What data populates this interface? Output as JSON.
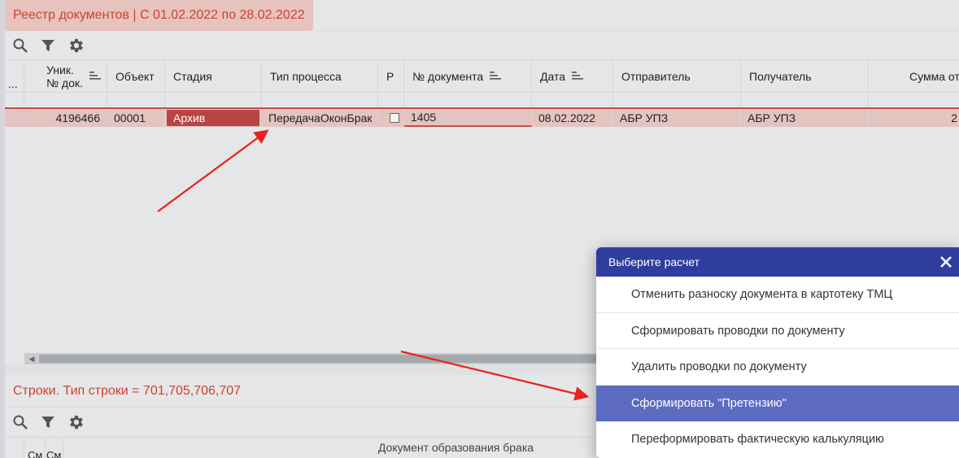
{
  "registry": {
    "title": "Реестр документов | С 01.02.2022 по 28.02.2022",
    "toolbar": {
      "search_icon": "search-icon",
      "filter_icon": "filter-icon",
      "settings_icon": "gear-icon"
    },
    "columns": {
      "expand": "...",
      "uniq": "Уник.\n№ док.",
      "object": "Объект",
      "stage": "Стадия",
      "process_type": "Тип процесса",
      "p": "Р",
      "doc_number": "№ документа",
      "date": "Дата",
      "sender": "Отправитель",
      "receiver": "Получатель",
      "sum": "Сумма от"
    },
    "rows": [
      {
        "uniq": "4196466",
        "object": "00001",
        "stage": "Архив",
        "process_type": "ПередачаОконБрак",
        "p_checked": false,
        "doc_number": "1405",
        "date": "08.02.2022",
        "sender": "АБР УПЗ",
        "receiver": "АБР УПЗ",
        "sum": "2"
      }
    ]
  },
  "rows_section": {
    "title": "Строки. Тип строки = 701,705,706,707",
    "columns": {
      "c1": "См",
      "c2": "См"
    },
    "group_header": "Документ образования брака"
  },
  "dialog": {
    "title": "Выберите расчет",
    "items": [
      {
        "label": "Отменить разноску документа в картотеку ТМЦ",
        "active": false
      },
      {
        "label": "Сформировать проводки по документу",
        "active": false
      },
      {
        "label": "Удалить проводки по документу",
        "active": false
      },
      {
        "label": "Сформировать \"Претензию\"",
        "active": true
      },
      {
        "label": "Переформировать фактическую калькуляцию",
        "active": false
      }
    ]
  },
  "colors": {
    "title_accent": "#d0422f",
    "stage_badge": "#b84542",
    "dialog_header": "#2f3e9e",
    "dialog_active": "#5c6bc0",
    "annotation_arrow": "#e8211d"
  }
}
